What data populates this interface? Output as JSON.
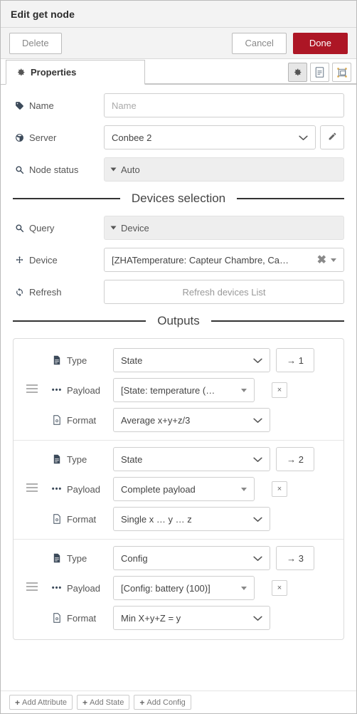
{
  "dialog": {
    "title": "Edit get node",
    "delete_label": "Delete",
    "cancel_label": "Cancel",
    "done_label": "Done",
    "done_color": "#ad1625"
  },
  "tabs": {
    "properties_label": "Properties",
    "properties_icon": "gear-icon",
    "tools": [
      {
        "name": "gear-icon",
        "active": true
      },
      {
        "name": "description-icon",
        "active": false
      },
      {
        "name": "appearance-icon",
        "active": false
      }
    ]
  },
  "properties": {
    "name": {
      "label": "Name",
      "icon": "tag-icon",
      "value": "",
      "placeholder": "Name"
    },
    "server": {
      "label": "Server",
      "icon": "globe-icon",
      "value": "Conbee 2",
      "edit_icon": "pencil-icon"
    },
    "node_status": {
      "label": "Node status",
      "icon": "search-icon",
      "value": "Auto"
    }
  },
  "devices_section": {
    "title": "Devices selection",
    "query": {
      "label": "Query",
      "icon": "search-icon",
      "value": "Device"
    },
    "device": {
      "label": "Device",
      "icon": "move-icon",
      "value": "[ZHATemperature: Capteur Chambre, Ca…",
      "clear_icon": "close-icon"
    },
    "refresh": {
      "label": "Refresh",
      "icon": "refresh-icon",
      "button_label": "Refresh devices List"
    }
  },
  "outputs_section": {
    "title": "Outputs",
    "labels": {
      "type": "Type",
      "payload": "Payload",
      "format": "Format"
    },
    "icons": {
      "type": "file-text-icon",
      "payload": "ellipsis-icon",
      "format": "format-file-icon",
      "drag": "drag-handle-icon",
      "delete": "close-icon"
    },
    "blocks": [
      {
        "type": "State",
        "payload": "[State: temperature (…",
        "format": "Average x+y+z/3",
        "port": "→ 1",
        "delete_label": "×"
      },
      {
        "type": "State",
        "payload": "Complete payload",
        "format": "Single x … y … z",
        "port": "→ 2",
        "delete_label": "×"
      },
      {
        "type": "Config",
        "payload": "[Config: battery (100)]",
        "format": "Min X+y+Z = y",
        "port": "→ 3",
        "delete_label": "×"
      }
    ]
  },
  "footer": {
    "add_attribute": "Add Attribute",
    "add_state": "Add State",
    "add_config": "Add Config",
    "plus": "+"
  }
}
